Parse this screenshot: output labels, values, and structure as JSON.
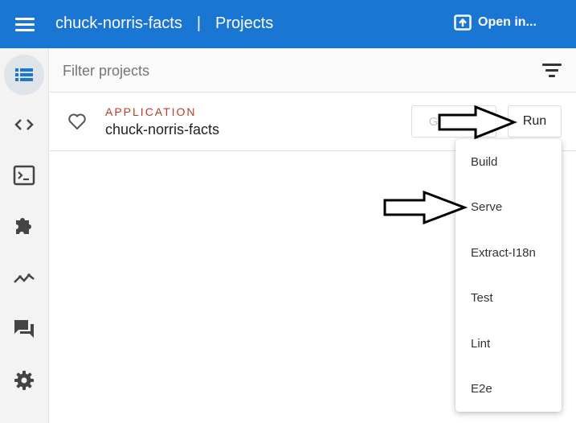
{
  "header": {
    "workspace": "chuck-norris-facts",
    "separator": "|",
    "section": "Projects",
    "open_in_label": "Open in..."
  },
  "rail": {
    "items": [
      {
        "icon": "list-icon",
        "active": true
      },
      {
        "icon": "code-icon"
      },
      {
        "icon": "terminal-icon"
      },
      {
        "icon": "puzzle-icon"
      },
      {
        "icon": "chart-line-icon"
      },
      {
        "icon": "chat-icon"
      },
      {
        "icon": "gear-icon"
      }
    ]
  },
  "filter": {
    "placeholder": "Filter projects"
  },
  "project": {
    "type": "APPLICATION",
    "name": "chuck-norris-facts",
    "generate_label": "Generate",
    "run_label": "Run"
  },
  "run_menu": {
    "items": [
      "Build",
      "Serve",
      "Extract-I18n",
      "Test",
      "Lint",
      "E2e"
    ]
  },
  "colors": {
    "primary": "#1976d2",
    "type_label": "#c0392b"
  }
}
